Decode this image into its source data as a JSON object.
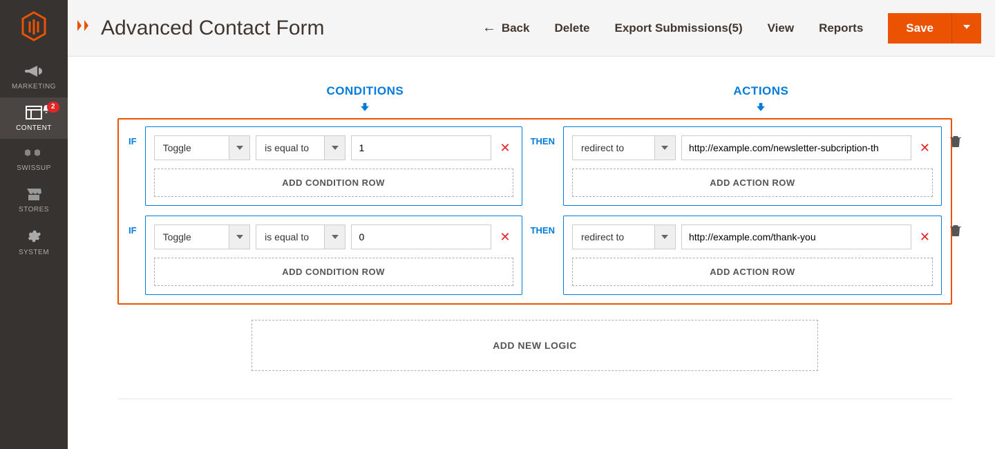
{
  "page": {
    "title": "Advanced Contact Form"
  },
  "sidebar": {
    "items": [
      {
        "label": "MARKETING"
      },
      {
        "label": "CONTENT",
        "badge": "2"
      },
      {
        "label": "SWISSUP"
      },
      {
        "label": "STORES"
      },
      {
        "label": "SYSTEM"
      }
    ]
  },
  "header": {
    "back": "Back",
    "delete": "Delete",
    "export": "Export Submissions(5)",
    "view": "View",
    "reports": "Reports",
    "save": "Save"
  },
  "section": {
    "conditions": "CONDITIONS",
    "actions": "ACTIONS",
    "if": "IF",
    "then": "THEN",
    "add_condition": "ADD CONDITION ROW",
    "add_action": "ADD ACTION ROW",
    "add_logic": "ADD NEW LOGIC"
  },
  "logic": [
    {
      "condition": {
        "field": "Toggle",
        "operator": "is equal to",
        "value": "1"
      },
      "action": {
        "type": "redirect to",
        "value": "http://example.com/newsletter-subcription-th"
      }
    },
    {
      "condition": {
        "field": "Toggle",
        "operator": "is equal to",
        "value": "0"
      },
      "action": {
        "type": "redirect to",
        "value": "http://example.com/thank-you"
      }
    }
  ]
}
